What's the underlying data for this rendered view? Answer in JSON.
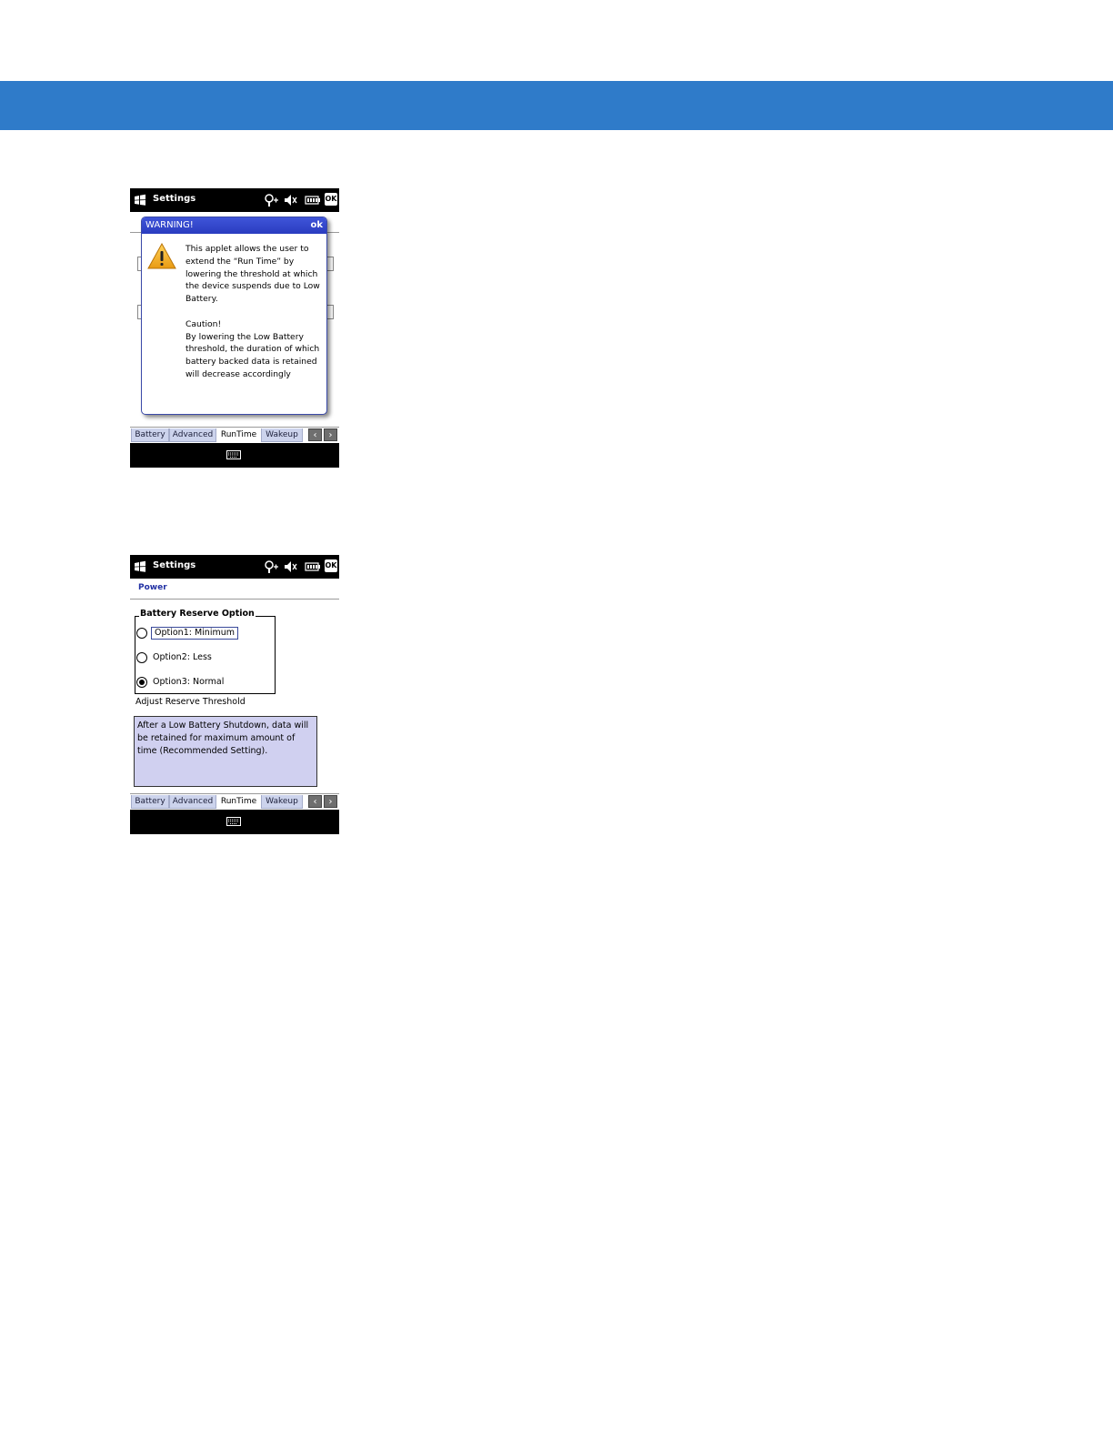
{
  "colors": {
    "banner": "#2f7bc9",
    "accent": "#2231a4",
    "tab_inactive": "#ccd3ec",
    "dialog_title": "#2f44cc",
    "desc_bg": "#d0d0f0"
  },
  "screen1": {
    "title": "Settings",
    "ok_label": "OK",
    "dialog": {
      "title": "WARNING!",
      "ok": "ok",
      "icon": "warning-icon",
      "text": "This applet allows the user to extend the “Run Time” by lowering the threshold at which the device suspends due to Low Battery.\n\nCaution!\nBy lowering the Low Battery threshold, the duration of which battery backed data is retained will decrease accordingly"
    },
    "tabs": [
      "Battery",
      "Advanced",
      "RunTime",
      "Wakeup"
    ]
  },
  "screen2": {
    "title": "Settings",
    "ok_label": "OK",
    "header": "Power",
    "group": {
      "title": "Battery Reserve Option",
      "options": [
        {
          "label": "Option1: Minimum",
          "selected": false
        },
        {
          "label": "Option2: Less",
          "selected": false
        },
        {
          "label": "Option3: Normal",
          "selected": true
        }
      ]
    },
    "adjust_label": "Adjust Reserve Threshold",
    "description": "After a Low Battery Shutdown, data will be retained for maximum amount of time (Recommended Setting).",
    "tabs": [
      "Battery",
      "Advanced",
      "RunTime",
      "Wakeup"
    ]
  }
}
